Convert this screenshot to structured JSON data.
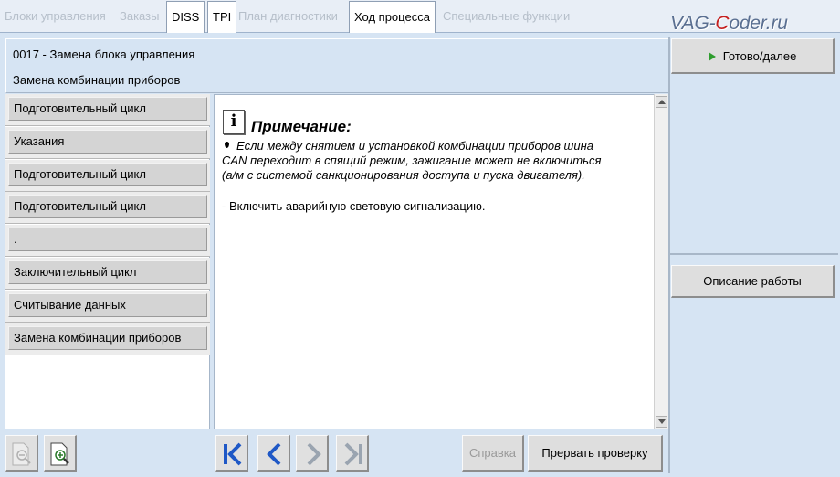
{
  "tabs": [
    {
      "label": "Блоки управления",
      "enabled": false
    },
    {
      "label": "Заказы",
      "enabled": false
    },
    {
      "label": "DISS",
      "enabled": true
    },
    {
      "label": "TPI",
      "enabled": true
    },
    {
      "label": "План диагностики",
      "enabled": false
    },
    {
      "label": "Ход процесса",
      "enabled": true,
      "active": true
    },
    {
      "label": "Специальные функции",
      "enabled": false
    }
  ],
  "logo": {
    "part1": "VAG-",
    "part2": "C",
    "part3": "oder.ru"
  },
  "header": {
    "line1": "0017 - Замена блока управления",
    "line2": "Замена комбинации приборов"
  },
  "steps": [
    "Подготовительный цикл",
    "Указания",
    "Подготовительный цикл",
    "Подготовительный цикл",
    ".",
    "Заключительный цикл",
    "Считывание данных",
    "Замена комбинации приборов"
  ],
  "content": {
    "note_title": "Примечание:",
    "note_lines": [
      "Если между снятием и установкой комбинации приборов шина",
      "CAN переходит в спящий режим, зажигание может не включиться",
      "(а/м с системой санкционирования доступа и пуска двигателя)."
    ],
    "step_text": "- Включить аварийную световую сигнализацию."
  },
  "buttons": {
    "ready_next": "Готово/далее",
    "work_description": "Описание работы",
    "help": "Справка",
    "abort_test": "Прервать проверку"
  },
  "colors": {
    "accent_blue": "#1f58c6",
    "ready_green": "#2e9d2e",
    "logo_red": "#c41e1e"
  }
}
